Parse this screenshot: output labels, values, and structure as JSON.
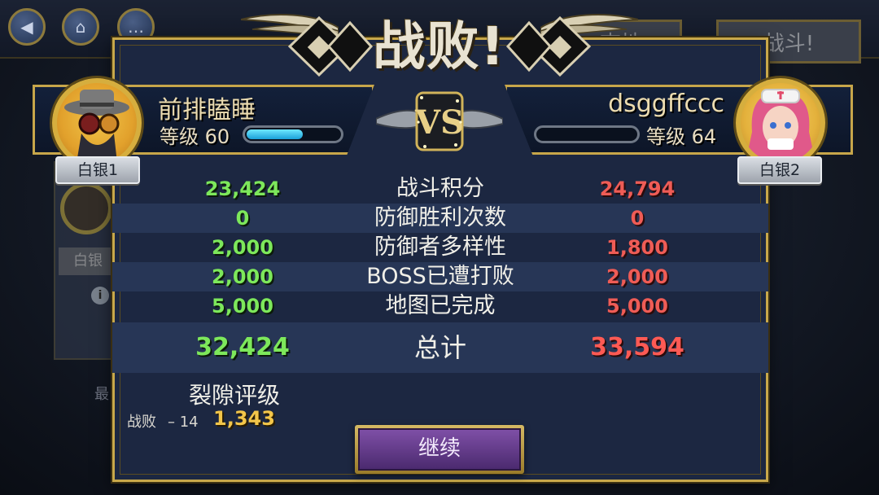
{
  "background": {
    "tab_right": "战斗!",
    "tab_mid": "查地",
    "card_label": "白银",
    "info_icon": "i",
    "bottom_text": "最"
  },
  "title": "战败!",
  "player_left": {
    "name": "前排瞌睡",
    "level_label": "等级",
    "level": "60",
    "xp_progress": 0.62,
    "rank": "白银1"
  },
  "player_right": {
    "name": "dsggffccc",
    "level_label": "等级",
    "level": "64",
    "xp_progress": 0,
    "rank": "白银2"
  },
  "vs_label": "VS",
  "stats": [
    {
      "label": "战斗积分",
      "left": "23,424",
      "right": "24,794"
    },
    {
      "label": "防御胜利次数",
      "left": "0",
      "right": "0"
    },
    {
      "label": "防御者多样性",
      "left": "2,000",
      "right": "1,800"
    },
    {
      "label": "BOSS已遭打败",
      "left": "2,000",
      "right": "2,000"
    },
    {
      "label": "地图已完成",
      "left": "5,000",
      "right": "5,000"
    }
  ],
  "total": {
    "label": "总计",
    "left": "32,424",
    "right": "33,594"
  },
  "rift": {
    "title": "裂隙评级",
    "result": "战败",
    "change": "– 14",
    "score": "1,343"
  },
  "continue_label": "继续",
  "colors": {
    "panel_bg": "#1c2741",
    "gold_border": "#c8a84a",
    "left_value": "#7de85b",
    "right_value": "#ef5c56",
    "rift_score": "#f3c64a",
    "continue_btn": "#5e3688"
  }
}
